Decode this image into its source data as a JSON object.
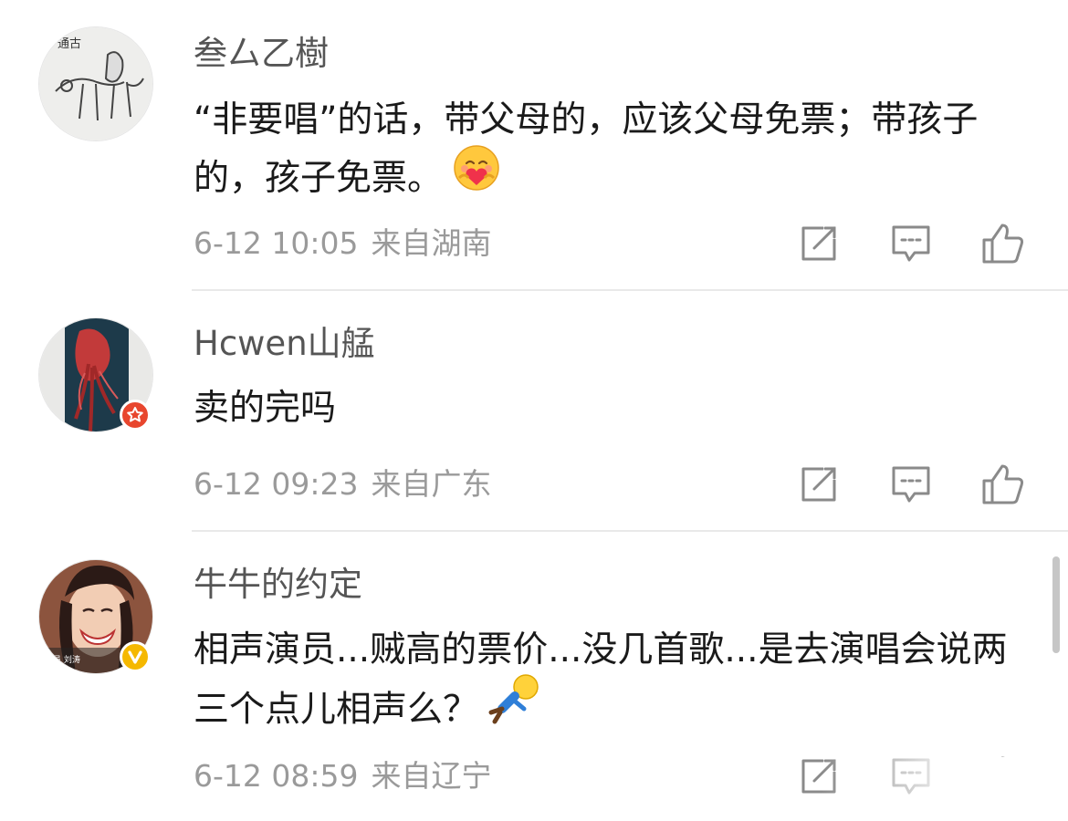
{
  "comments": [
    {
      "username": "叁厶乙樹",
      "text": "“非要唱”的话，带父母的，应该父母免票；带孩子的，孩子免票。",
      "emoji": "hugging-heart-emoji",
      "time": "6-12 10:05",
      "location": "来自湖南"
    },
    {
      "username": "Hcwen山艋",
      "text": "卖的完吗",
      "badge": "red-star-badge",
      "time": "6-12 09:23",
      "location": "来自广东"
    },
    {
      "username": "牛牛的约定",
      "text": "相声演员...贼高的票价...没几首歌...是去演唱会说两三个点儿相声么？",
      "emoji": "fallen-figure-emoji",
      "badge": "yellow-verified-badge",
      "time": "6-12 08:59",
      "location": "来自辽宁"
    }
  ],
  "colors": {
    "username": "#555555",
    "text": "#1a1a1a",
    "meta": "#9a9a9a",
    "icon": "#8a8a8a",
    "divider": "#e9e9e9",
    "badge_red": "#e8462e",
    "badge_yellow": "#f5b800"
  },
  "icons": [
    "share-icon",
    "comment-icon",
    "like-icon"
  ]
}
